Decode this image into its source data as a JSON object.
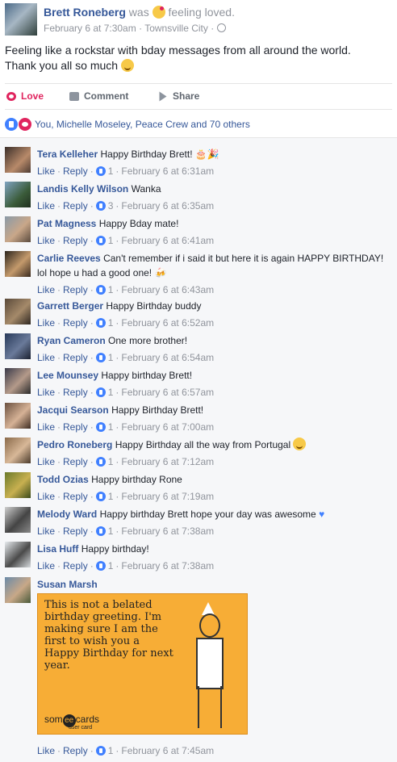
{
  "post": {
    "author": "Brett Roneberg",
    "was": "was",
    "feeling": "feeling loved.",
    "date": "February 6 at 7:30am",
    "dot": "·",
    "location": "Townsville City",
    "text": "Feeling like a rockstar with bday messages from all around the world. Thank you all so much"
  },
  "actions": {
    "love": "Love",
    "comment": "Comment",
    "share": "Share"
  },
  "reactions": {
    "summary": "You, Michelle Moseley, Peace Crew and 70 others"
  },
  "comment_meta": {
    "like": "Like",
    "reply": "Reply",
    "dot": "·"
  },
  "comments": [
    {
      "name": "Tera Kelleher",
      "text": "Happy Birthday Brett!",
      "likes": "1",
      "time": "February 6 at 6:31am"
    },
    {
      "name": "Landis Kelly Wilson",
      "text": "Wanka",
      "likes": "3",
      "time": "February 6 at 6:35am"
    },
    {
      "name": "Pat Magness",
      "text": "Happy Bday mate!",
      "likes": "1",
      "time": "February 6 at 6:41am"
    },
    {
      "name": "Carlie Reeves",
      "text": "Can't remember if i said it but here it is again HAPPY BIRTHDAY! lol hope u had a good one!",
      "likes": "1",
      "time": "February 6 at 6:43am"
    },
    {
      "name": "Garrett Berger",
      "text": "Happy Birthday buddy",
      "likes": "1",
      "time": "February 6 at 6:52am"
    },
    {
      "name": "Ryan Cameron",
      "text": "One more brother!",
      "likes": "1",
      "time": "February 6 at 6:54am"
    },
    {
      "name": "Lee Mounsey",
      "text": "Happy birthday Brett!",
      "likes": "1",
      "time": "February 6 at 6:57am"
    },
    {
      "name": "Jacqui Searson",
      "text": "Happy Birthday Brett!",
      "likes": "1",
      "time": "February 6 at 7:00am"
    },
    {
      "name": "Pedro Roneberg",
      "text": "Happy Birthday all the way from Portugal",
      "likes": "1",
      "time": "February 6 at 7:12am"
    },
    {
      "name": "Todd Ozias",
      "text": "Happy birthday Rone",
      "likes": "1",
      "time": "February 6 at 7:19am"
    },
    {
      "name": "Melody Ward",
      "text": "Happy birthday Brett hope your day was awesome",
      "likes": "1",
      "time": "February 6 at 7:38am"
    },
    {
      "name": "Lisa Huff",
      "text": "Happy birthday!",
      "likes": "1",
      "time": "February 6 at 7:38am"
    },
    {
      "name": "Susan Marsh",
      "text": "",
      "likes": "1",
      "time": "February 6 at 7:45am"
    }
  ],
  "card": {
    "text": "This is not a belated birthday greeting. I'm making sure I am the first to wish you a Happy Birthday for next year.",
    "logo_left": "som",
    "logo_ee": "ee",
    "logo_right": "cards",
    "logo_sub": "user card"
  },
  "colors": {
    "link": "#365899",
    "muted": "#90949c",
    "love": "#e0245e",
    "like": "#4080ff",
    "card_bg": "#f7ad36"
  }
}
